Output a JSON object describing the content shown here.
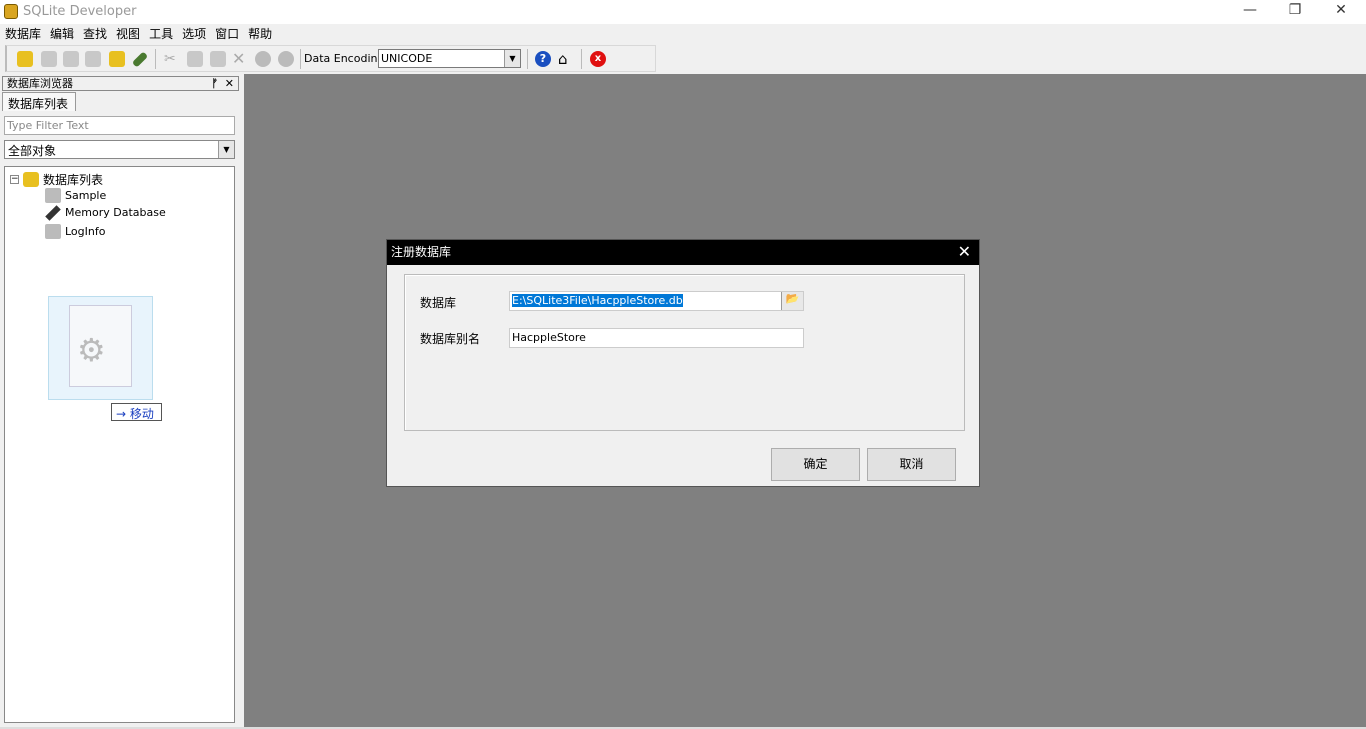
{
  "window": {
    "title": "SQLite Developer"
  },
  "menu": [
    "数据库",
    "编辑",
    "查找",
    "视图",
    "工具",
    "选项",
    "窗口",
    "帮助"
  ],
  "toolbar": {
    "encoding_label": "Data Encoding:",
    "encoding_value": "UNICODE"
  },
  "panel": {
    "title": "数据库浏览器",
    "tab": "数据库列表",
    "filter_placeholder": "Type Filter Text",
    "object_filter": "全部对象",
    "tree": {
      "root": "数据库列表",
      "items": [
        "Sample",
        "Memory Database",
        "LogInfo"
      ]
    }
  },
  "drag": {
    "label": "移动",
    "arrow": "→"
  },
  "dialog": {
    "title": "注册数据库",
    "db_label": "数据库",
    "db_value": "E:\\SQLite3File\\HacppleStore.db",
    "alias_label": "数据库别名",
    "alias_value": "HacppleStore",
    "ok": "确定",
    "cancel": "取消"
  }
}
